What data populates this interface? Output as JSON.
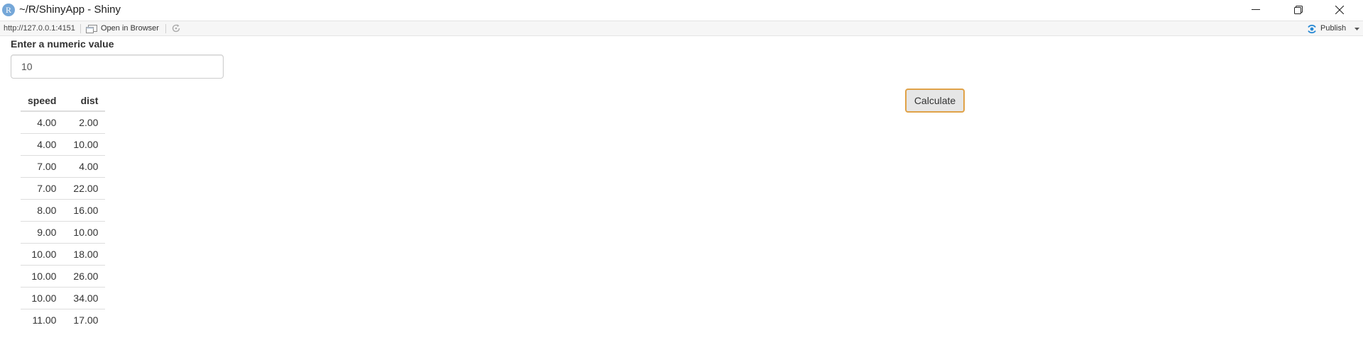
{
  "window": {
    "app_icon_letter": "R",
    "title": "~/R/ShinyApp - Shiny",
    "controls": {
      "minimize_icon": "minimize-icon",
      "maximize_icon": "restore-icon",
      "close_icon": "close-icon"
    }
  },
  "toolbar": {
    "url": "http://127.0.0.1:4151",
    "open_in_browser_label": "Open in Browser",
    "open_in_browser_icon": "open-in-browser-icon",
    "refresh_icon": "refresh-icon",
    "publish_label": "Publish",
    "publish_icon": "publish-icon",
    "accent_color": "#2a8ad4"
  },
  "form": {
    "label": "Enter a numeric value",
    "input_value": "10",
    "button_label": "Calculate",
    "button_focus_color": "#e0a247"
  },
  "table": {
    "headers": [
      "speed",
      "dist"
    ],
    "rows": [
      [
        "4.00",
        "2.00"
      ],
      [
        "4.00",
        "10.00"
      ],
      [
        "7.00",
        "4.00"
      ],
      [
        "7.00",
        "22.00"
      ],
      [
        "8.00",
        "16.00"
      ],
      [
        "9.00",
        "10.00"
      ],
      [
        "10.00",
        "18.00"
      ],
      [
        "10.00",
        "26.00"
      ],
      [
        "10.00",
        "34.00"
      ],
      [
        "11.00",
        "17.00"
      ]
    ]
  }
}
